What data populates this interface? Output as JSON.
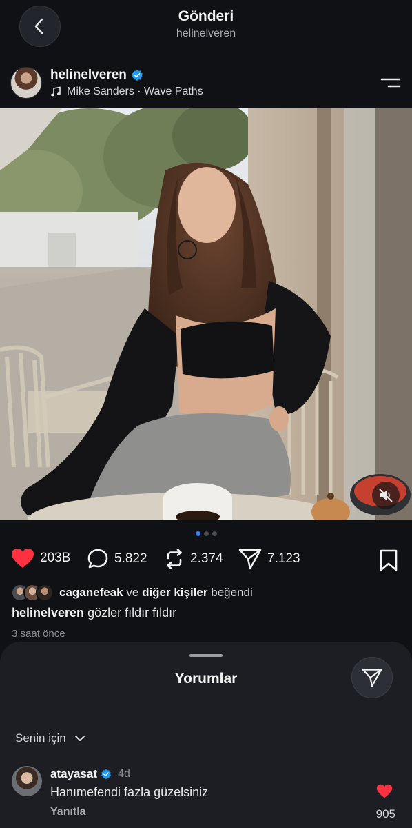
{
  "header": {
    "title": "Gönderi",
    "subtitle": "helinelveren"
  },
  "post": {
    "author": "helinelveren",
    "verified": true,
    "music": "Mike Sanders · Wave Paths",
    "carousel": {
      "total": 3,
      "active": 1
    }
  },
  "actions": {
    "likes": "203B",
    "comments": "5.822",
    "reposts": "2.374",
    "shares": "7.123"
  },
  "liked_by": {
    "user": "caganefeak",
    "connector": "ve",
    "others": "diğer kişiler",
    "suffix": "beğendi"
  },
  "caption": {
    "user": "helinelveren",
    "text": "gözler fıldır fıldır"
  },
  "time_ago": "3 saat önce",
  "comments_sheet": {
    "title": "Yorumlar",
    "filter_label": "Senin için",
    "comments": [
      {
        "user": "atayasat",
        "verified": true,
        "age": "4d",
        "text": "Hanımefendi fazla güzelsiniz",
        "reply_label": "Yanıtla",
        "likes": "905",
        "liked": true
      }
    ]
  },
  "colors": {
    "background": "#0f1115",
    "sheet": "#1c1e23",
    "like_red": "#ff3040",
    "verified_blue": "#1d9bf0",
    "dot_active": "#3b82f6"
  },
  "icons": [
    "back-icon",
    "verified-icon",
    "music-icon",
    "menu-icon",
    "mute-icon",
    "heart-icon",
    "comment-icon",
    "repost-icon",
    "share-icon",
    "bookmark-icon",
    "chevron-down-icon",
    "send-icon"
  ]
}
